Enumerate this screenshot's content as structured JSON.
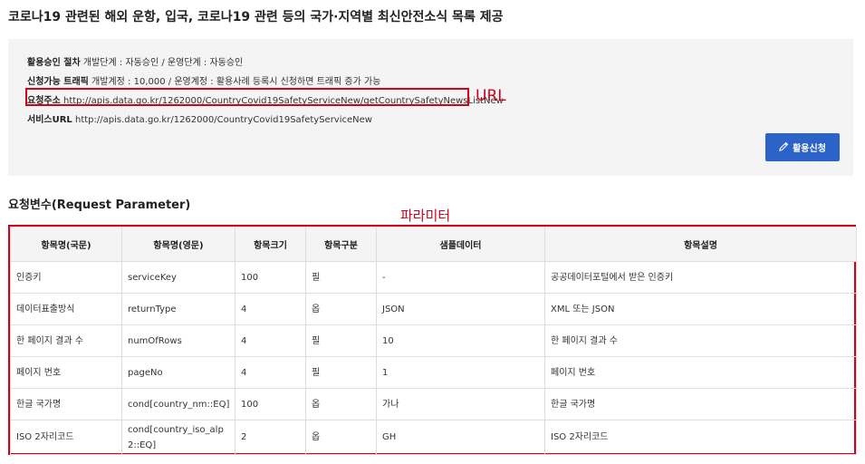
{
  "page": {
    "title": "코로나19 관련된 해외 운항, 입국, 코로나19 관련 등의 국가·지역별 최신안전소식 목록 제공"
  },
  "info": {
    "approval_label": "활용승인 절차",
    "approval_value": "개발단계 : 자동승인 / 운영단계 : 자동승인",
    "traffic_label": "신청가능 트래픽",
    "traffic_value": "개발계정 : 10,000 / 운영계정 : 활용사례 등록시 신청하면 트래픽 증가 가능",
    "request_label": "요청주소",
    "request_value": "http://apis.data.go.kr/1262000/CountryCovid19SafetyServiceNew/getCountrySafetyNewsListNew",
    "service_label": "서비스URL",
    "service_value": "http://apis.data.go.kr/1262000/CountryCovid19SafetyServiceNew",
    "apply_button": "활용신청"
  },
  "annotations": {
    "url": "URL",
    "param": "파라미터",
    "color": "#d0021b"
  },
  "section": {
    "title": "요청변수(Request Parameter)"
  },
  "table": {
    "headers": [
      "항목명(국문)",
      "항목명(영문)",
      "항목크기",
      "항목구분",
      "샘플데이터",
      "항목설명"
    ],
    "rows": [
      [
        "인증키",
        "serviceKey",
        "100",
        "필",
        "-",
        "공공데이터포털에서 받은 인증키"
      ],
      [
        "데이터표출방식",
        "returnType",
        "4",
        "옵",
        "JSON",
        "XML 또는 JSON"
      ],
      [
        "한 페이지 결과 수",
        "numOfRows",
        "4",
        "필",
        "10",
        "한 페이지 결과 수"
      ],
      [
        "페이지 번호",
        "pageNo",
        "4",
        "필",
        "1",
        "페이지 번호"
      ],
      [
        "한글 국가명",
        "cond[country_nm::EQ]",
        "100",
        "옵",
        "가나",
        "한글 국가명"
      ],
      [
        "ISO 2자리코드",
        "cond[country_iso_alp2::EQ]",
        "2",
        "옵",
        "GH",
        "ISO 2자리코드"
      ]
    ]
  }
}
